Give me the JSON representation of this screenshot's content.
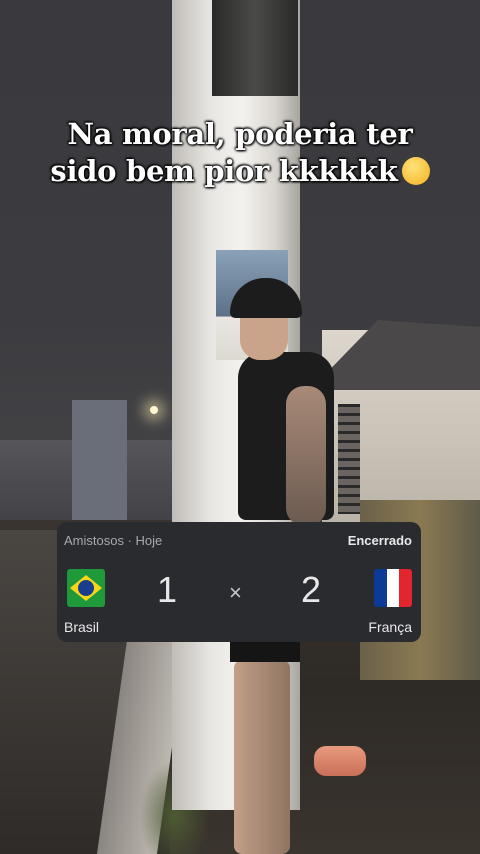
{
  "caption": {
    "line1": "Na moral, poderia ter",
    "line2": "sido bem pior kkkkkk",
    "emoji": "grinning-face-with-sweat-emoji"
  },
  "match_card": {
    "competition": "Amistosos · Hoje",
    "status": "Encerrado",
    "home_team": "Brasil",
    "home_score": "1",
    "separator": "×",
    "away_score": "2",
    "away_team": "França",
    "home_flag": "brazil-flag",
    "away_flag": "france-flag",
    "colors": {
      "card_bg": "#2a2b2f",
      "brazil_green": "#1e9a3b",
      "brazil_yellow": "#f7d618",
      "brazil_blue": "#1b3e8c",
      "france_blue": "#0c3b96",
      "france_white": "#ffffff",
      "france_red": "#e2262f"
    }
  }
}
